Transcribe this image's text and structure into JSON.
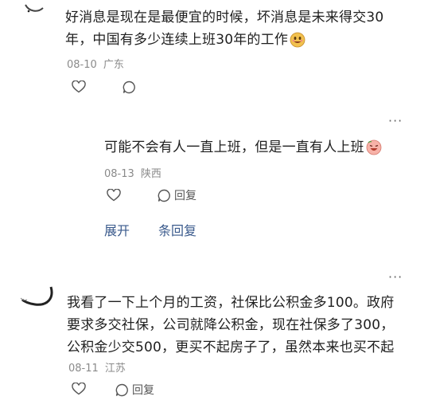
{
  "comments": [
    {
      "text_line1": "好消息是现在是最便宜的时候，坏消息是未来得交30",
      "text_line2": "年，中国有多少连续上班30年的工作",
      "date": "08-10",
      "location": "广东",
      "emoji": "beaming-face-emoji"
    },
    {
      "text": "可能不会有人一直上班，但是一直有人上班",
      "date": "08-13",
      "location": "陕西",
      "reply_label": "回复",
      "emoji": "laughing-face-emoji"
    },
    {
      "text_line1": "我看了一下上个月的工资，社保比公积金多100。政府",
      "text_line2": "要求多交社保，公司就降公积金，现在社保多了300，",
      "text_line3": "公积金少交500，更买不起房子了，虽然本来也买不起",
      "date": "08-11",
      "location": "江苏",
      "reply_label": "回复"
    }
  ],
  "expand": {
    "prefix": "展开",
    "suffix": "条回复"
  },
  "more_label": "···",
  "colors": {
    "text": "#1f1f1f",
    "meta": "#8a8a8a",
    "link": "#3a5a8c"
  }
}
